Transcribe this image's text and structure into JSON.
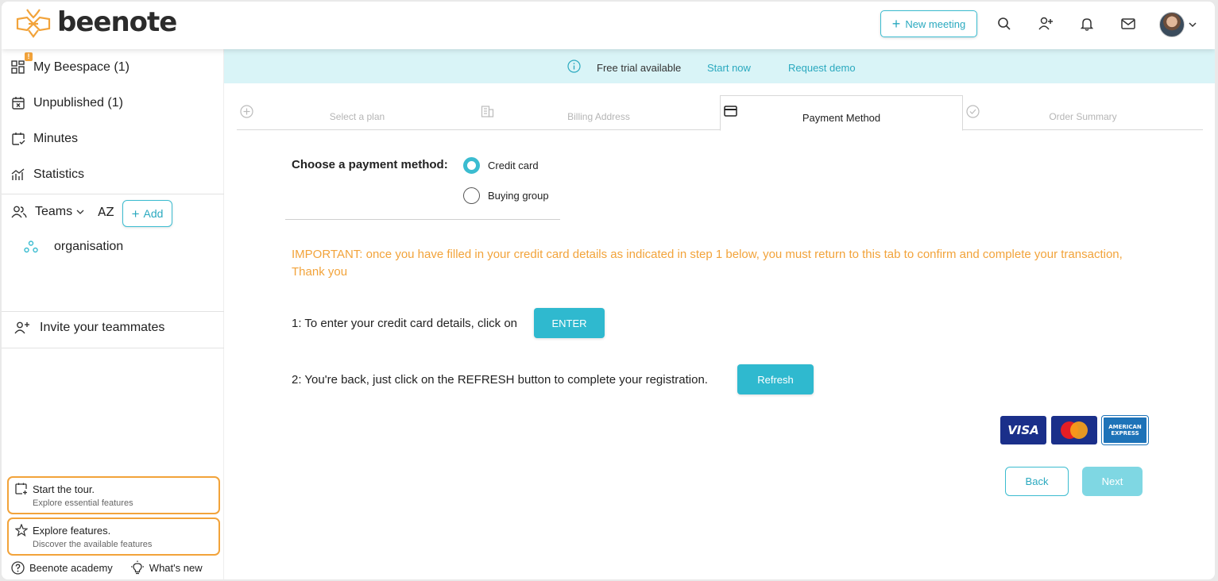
{
  "header": {
    "logo_text": "beenote",
    "new_meeting_label": "New meeting"
  },
  "sidebar": {
    "items": [
      {
        "label": "My Beespace (1)",
        "badge": "!"
      },
      {
        "label": "Unpublished (1)"
      },
      {
        "label": "Minutes"
      },
      {
        "label": "Statistics"
      }
    ],
    "teams_label": "Teams",
    "sort_label": "AZ",
    "add_label": "Add",
    "organisation_label": "organisation",
    "invite_label": "Invite your teammates",
    "tour_card": {
      "title": "Start the tour.",
      "subtitle": "Explore essential features"
    },
    "features_card": {
      "title": "Explore features.",
      "subtitle": "Discover the available features"
    },
    "academy_label": "Beenote academy",
    "whats_new_label": "What's new"
  },
  "banner": {
    "text": "Free trial available",
    "start_now": "Start now",
    "request_demo": "Request demo"
  },
  "steps": [
    {
      "label": "Select a plan",
      "active": false
    },
    {
      "label": "Billing Address",
      "active": false
    },
    {
      "label": "Payment Method",
      "active": true
    },
    {
      "label": "Order Summary",
      "active": false
    }
  ],
  "payment": {
    "choose_label": "Choose a payment method:",
    "options": [
      {
        "label": "Credit card",
        "selected": true
      },
      {
        "label": "Buying group",
        "selected": false
      }
    ],
    "important": "IMPORTANT: once you have filled in your credit card details as indicated in step 1 below, you must return to this tab to confirm and complete your transaction, Thank you",
    "step1": "1: To enter your credit card details, click on",
    "enter_label": "ENTER",
    "step2": "2: You're back, just click on the REFRESH button to complete your registration.",
    "refresh_label": "Refresh",
    "cards": {
      "visa": "VISA",
      "mastercard": "MasterCard",
      "amex": "AMERICAN EXPRESS"
    },
    "back_label": "Back",
    "next_label": "Next"
  },
  "colors": {
    "accent": "#2fb9cf",
    "warning": "#f2a33a",
    "banner_bg": "#d9f4f7"
  }
}
